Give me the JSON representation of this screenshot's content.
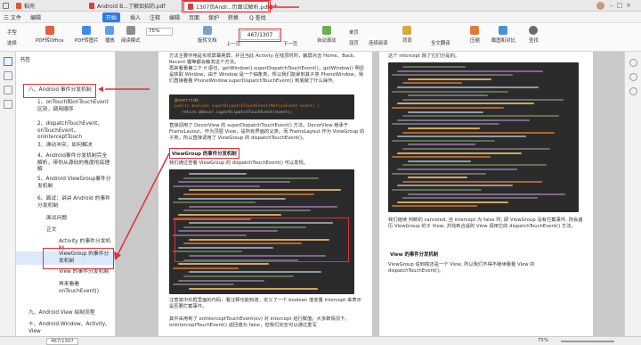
{
  "tabs": [
    {
      "label": "稻壳"
    },
    {
      "label": "Android B...了解如招的.pdf"
    },
    {
      "label": "1307页Andr...历面试解析.pdf"
    }
  ],
  "menu": {
    "items": [
      "三 文件",
      "编辑",
      "页面",
      "开始",
      "插入",
      "注释",
      "编辑",
      "页面",
      "保护",
      "转换",
      "Q 查找"
    ]
  },
  "toolbar": {
    "hand": "手型",
    "select": "选择",
    "pdf_to_office": "PDF转Office",
    "pdf_to_image": "PDF转图片",
    "play": "播放",
    "read_mode": "阅读模式",
    "zoom": "75%",
    "rotate": "旋转文档",
    "prev": "上一页",
    "page": "467/1307",
    "next": "下一页",
    "auto_scroll": "自动滚动",
    "single_page": "单页",
    "double_page": "双页",
    "continuous": "连续阅读",
    "background": "背景",
    "full_translate": "全文翻译",
    "compress": "压缩",
    "screenshot": "截图和对比",
    "search": "查找"
  },
  "outline": {
    "header": "书签",
    "items": [
      {
        "label": "八、Android 事件分发机制"
      },
      {
        "label": "1、onTouch和onTouchEvent 区别，调用顺序"
      },
      {
        "label": "2、dispatchTouchEvent，onTouchEvent，onInterceptTouch"
      },
      {
        "label": "3、滑动冲突，如何解决"
      },
      {
        "label": "4、Android事件分发机制完全解析，带你从源码的角度彻底理解"
      },
      {
        "label": "5、Android ViewGroup事件分发机制"
      },
      {
        "label": "6、面试：讲讲 Android 的事件分发机制"
      },
      {
        "label": "面试问题"
      },
      {
        "label": "正文"
      },
      {
        "label": "Activity 的事件分发机制"
      },
      {
        "label": "ViewGroup 的事件分发机制"
      },
      {
        "label": "View 的事件分发机制"
      },
      {
        "label": "再来看看 onTouchEvent()"
      },
      {
        "label": "九、Android View 绘制流程"
      },
      {
        "label": "十、Android Window、Activity、View"
      }
    ]
  },
  "doc": {
    "left_intro": "方法主要作用是实现屏幕亮屏，并且当此 Activity 在栈顶时时，触屏点击 Home、Back、Recent 键等都会触发这个方法。",
    "left_p2": "再来看看第二个 if 语句，getWindow().superDispatchTouchEvent()，getWindow() 明显是获取 Window，由于 Window 是一个抽象类，所以我们能拿到其子类 PhoneWindow，我们直接看看 PhoneWindow.superDispatchTouchEvent() 到底做了什么操作。",
    "left_p3": "直接调用了 DecorView 的 superDispatchTouchEvent() 方法。DecorView 继承于 FrameLayout，作为顶层 View，是所有界面的父类。而 FrameLayout 作为 ViewGroup 的子类，所以直接调用了 ViewGroup 的 dispatchTouchEvent()。",
    "left_heading": "ViewGroup 的事件分发机制",
    "left_p4": "我们通过查看 ViewGroup 的 dispatchTouchEvent() 可以发现。",
    "left_p5": "注意其中红框里面的代码，看注释也能知道，定义了一个 boolean 值变量 intercept 来表示是否要拦截事件。",
    "left_p6": "其中采用到了 onInterceptTouchEvent(ev) 对 intercept 进行赋值。大多数情况下，onInterceptTouchEvent() 返回值为 false，但我们完全可以通过重写",
    "right_intro": "这个 intercept 除了它们分是的。",
    "right_p1": "我们继续 判断的 canceled, 当 intercept 为 false 时, 即 ViewGroup 没有拦截事件, 则会遍历 ViewGroup 的子 View, 并找到合适的 View 调用它的 dispatchTouchEvent() 方法。",
    "right_heading": "View 的事件分发机制",
    "right_p2": "ViewGroup 说到底还是一个 View, 所以我们不得不继续看看 View 的 dispatchTouchEvent()。",
    "code_tag": "@override",
    "code_sig": "public boolean superDispatchTouchEvent(MotionEvent event) {",
    "code_ret": "return mDecor.superDispatchTouchEvent(event);"
  },
  "status": {
    "page": "467/1307",
    "zoom": "75%"
  }
}
